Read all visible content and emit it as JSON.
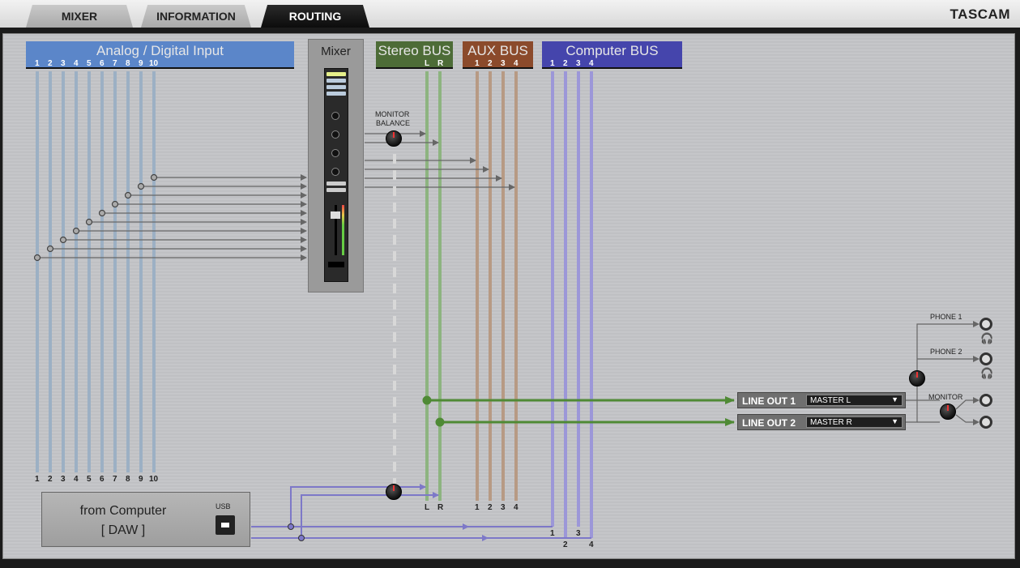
{
  "tabs": [
    {
      "label": "MIXER",
      "active": false
    },
    {
      "label": "INFORMATION",
      "active": false
    },
    {
      "label": "ROUTING",
      "active": true
    }
  ],
  "brand": "TASCAM",
  "buses": {
    "analog": {
      "title": "Analog / Digital Input",
      "channels": [
        "1",
        "2",
        "3",
        "4",
        "5",
        "6",
        "7",
        "8",
        "9",
        "10"
      ],
      "color": "#5b86c9"
    },
    "mixer": {
      "title": "Mixer"
    },
    "stereo": {
      "title": "Stereo BUS",
      "channels": [
        "L",
        "R"
      ],
      "color": "#4d6c37"
    },
    "aux": {
      "title": "AUX BUS",
      "channels": [
        "1",
        "2",
        "3",
        "4"
      ],
      "color": "#8b4a2b"
    },
    "computer": {
      "title": "Computer BUS",
      "channels": [
        "1",
        "2",
        "3",
        "4"
      ],
      "color": "#4545ac"
    }
  },
  "monitor_balance_label": [
    "MONITOR",
    "BALANCE"
  ],
  "outputs": {
    "line_out_1": {
      "label": "LINE OUT 1",
      "value": "MASTER L"
    },
    "line_out_2": {
      "label": "LINE OUT 2",
      "value": "MASTER R"
    },
    "phone_1": "PHONE 1",
    "phone_2": "PHONE 2",
    "monitor": "MONITOR"
  },
  "daw": {
    "line1": "from Computer",
    "line2": "[ DAW ]",
    "usb": "USB"
  },
  "colors": {
    "analog_line": "#9cb0c4",
    "stereo_line": "#8db480",
    "aux_line": "#b79a84",
    "computer_line": "#9c97d8",
    "green_route": "#4f8a35",
    "arrow": "#666666"
  }
}
